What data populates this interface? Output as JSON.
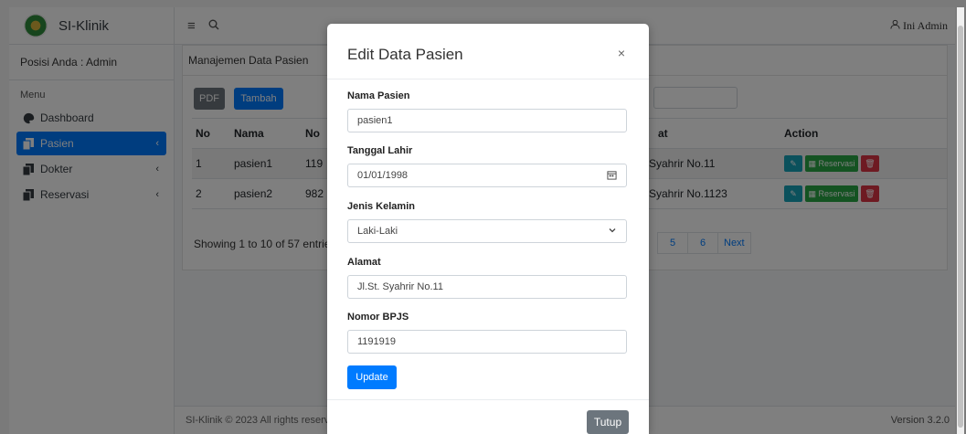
{
  "sidebar": {
    "brand": "SI-Klinik",
    "position": "Posisi Anda : Admin",
    "menu_header": "Menu",
    "items": [
      {
        "label": "Dashboard",
        "icon": "palette-icon"
      },
      {
        "label": "Pasien",
        "icon": "copy-icon",
        "chevron": "‹"
      },
      {
        "label": "Dokter",
        "icon": "copy-icon",
        "chevron": "‹"
      },
      {
        "label": "Reservasi",
        "icon": "copy-icon",
        "chevron": "‹"
      }
    ]
  },
  "navbar": {
    "user": "Ini Admin"
  },
  "content": {
    "title": "Manajemen Data Pasien",
    "pdf_label": "PDF",
    "add_label": "Tambah",
    "columns": [
      "No",
      "Nama",
      "No",
      "at",
      "Action"
    ],
    "rows": [
      {
        "no": "1",
        "nama": "pasien1",
        "nobpjs": "119",
        "alamat": "Syahrir No.11"
      },
      {
        "no": "2",
        "nama": "pasien2",
        "nobpjs": "982",
        "alamat": "Syahrir No.1123"
      }
    ],
    "reservasi_label": "Reservasi",
    "entries": "Showing 1 to 10 of 57 entries",
    "pages": [
      "5",
      "6",
      "Next"
    ]
  },
  "footer": {
    "left": "SI-Klinik © 2023 All rights reserv",
    "right": "Version 3.2.0"
  },
  "modal": {
    "title": "Edit Data Pasien",
    "close": "×",
    "fields": {
      "nama_label": "Nama Pasien",
      "nama_value": "pasien1",
      "tgl_label": "Tanggal Lahir",
      "tgl_value": "01/01/1998",
      "jk_label": "Jenis Kelamin",
      "jk_value": "Laki-Laki",
      "alamat_label": "Alamat",
      "alamat_value": "Jl.St. Syahrir No.11",
      "bpjs_label": "Nomor BPJS",
      "bpjs_value": "1191919"
    },
    "update_label": "Update",
    "close_label": "Tutup"
  }
}
